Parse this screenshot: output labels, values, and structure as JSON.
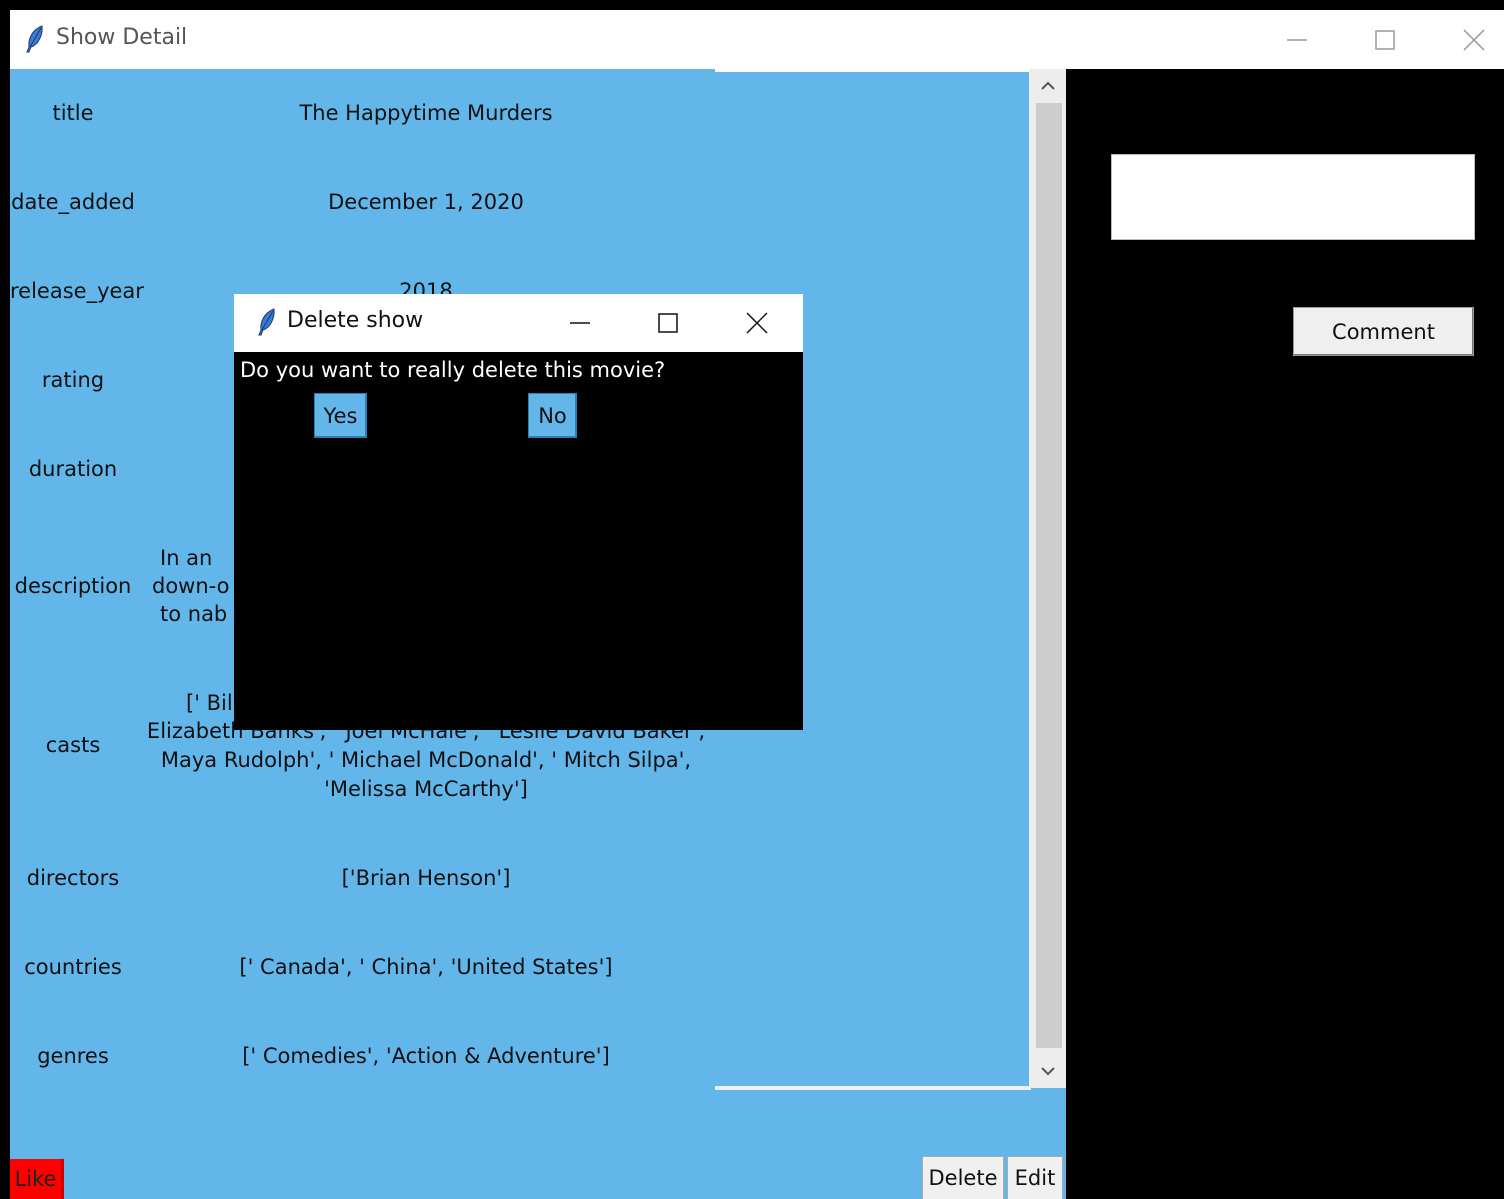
{
  "window": {
    "title": "Show Detail"
  },
  "detail": {
    "rows": [
      {
        "label": "title",
        "value": "The Happytime Murders"
      },
      {
        "label": "date_added",
        "value": "December 1, 2020"
      },
      {
        "label": "release_year",
        "value": "2018"
      },
      {
        "label": "rating",
        "value": ""
      },
      {
        "label": "duration",
        "value": ""
      },
      {
        "label": "description",
        "value_lines": [
          "In an",
          "down-o",
          "to nab"
        ]
      },
      {
        "label": "casts",
        "value_lines": [
          "[' Bill",
          "Elizabeth Banks', ' Joel McHale', ' Leslie David Baker',",
          "Maya Rudolph', ' Michael McDonald', ' Mitch Silpa',",
          "'Melissa McCarthy']"
        ]
      },
      {
        "label": "directors",
        "value": "['Brian Henson']"
      },
      {
        "label": "countries",
        "value": "[' Canada', ' China', 'United States']"
      },
      {
        "label": "genres",
        "value": "[' Comedies', 'Action & Adventure']"
      }
    ]
  },
  "actions": {
    "like_label": "Like",
    "delete_label": "Delete",
    "edit_label": "Edit"
  },
  "comment": {
    "input_value": "",
    "button_label": "Comment"
  },
  "dialog": {
    "title": "Delete show",
    "message": "Do you want to really delete this movie?",
    "yes_label": "Yes",
    "no_label": "No"
  },
  "colors": {
    "panel_blue": "#62b6ea",
    "like_red": "#ff0000",
    "background": "#000000"
  }
}
